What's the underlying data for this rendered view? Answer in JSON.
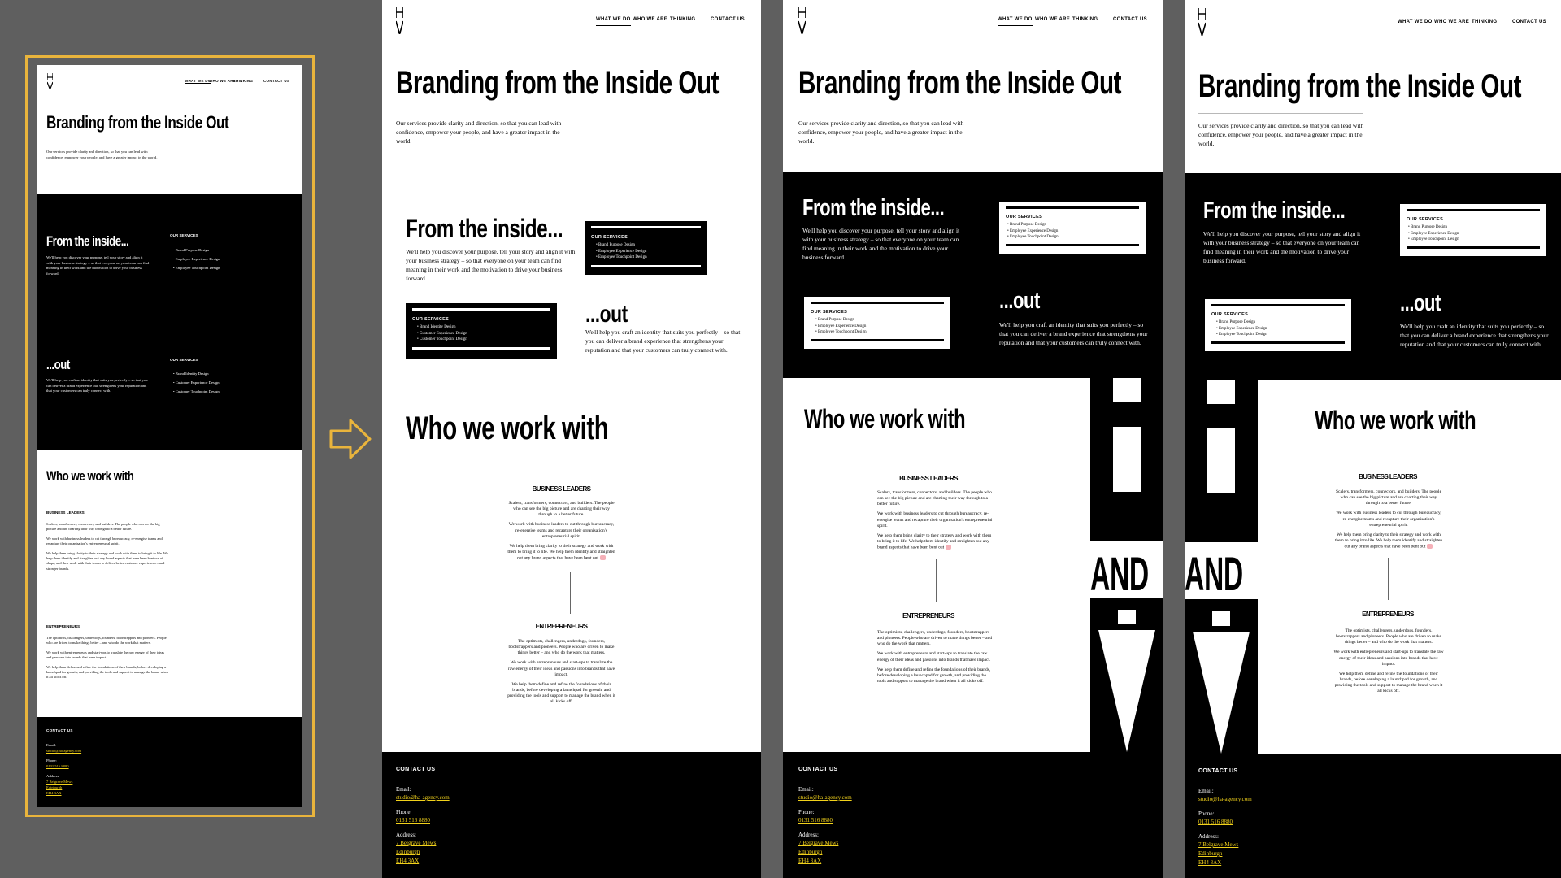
{
  "site": {
    "nav": {
      "what_we_do": "WHAT WE DO",
      "who_we_are": "WHO WE ARE",
      "thinking": "THINKING",
      "contact_us": "CONTACT US"
    },
    "hero": {
      "title": "Branding from the Inside Out",
      "intro": "Our services provide clarity and direction, so that you can lead with confidence, empower your people, and have a greater impact in the world."
    },
    "inside": {
      "title": "From the inside...",
      "body": "We'll help you discover your purpose, tell your story and align it with your business strategy – so that everyone on your team can find meaning in their work and the motivation to drive your business forward.",
      "services_title": "OUR SERVICES",
      "services": [
        "Brand Purpose Design",
        "Employee Experience Design",
        "Employee Touchpoint Design"
      ]
    },
    "out": {
      "title": "...out",
      "body": "We'll help you craft an identity that suits you perfectly – so that you can deliver a brand experience that strengthens your reputation and that your customers can truly connect with.",
      "services_title": "OUR SERVICES",
      "services": [
        "Brand Identity Design",
        "Customer Experience Design",
        "Customer Touchpoint Design"
      ],
      "services_alt": [
        "Brand Purpose Design",
        "Employee Experience Design",
        "Employee Touchpoint Design"
      ]
    },
    "who": {
      "title": "Who we work with",
      "leaders_title": "BUSINESS LEADERS",
      "leaders_p1": "Scalers, transformers, connectors, and builders. The people who can see the big picture and are charting their way through to a better future.",
      "leaders_p2": "We work with business leaders to cut through bureaucracy, re-energise teams and recapture their organisation's entrepreneurial spirit.",
      "leaders_p3": "We help them bring clarity to their strategy and work with them to bring it to life. We help them identify and straighten out any brand aspects that have been bent out of shape, and then work with their teams to deliver better customer experiences – and stronger brands.",
      "leaders_p3_short": "We help them bring clarity to their strategy and work with them to bring it to life. We help them identify and straighten out any brand aspects that have been bent out",
      "entre_title": "ENTREPRENEURS",
      "entre_p1": "The optimists, challengers, underdogs, founders, bootstrappers and pioneers. People who are driven to make things better – and who do the work that matters.",
      "entre_p2": "We work with entrepreneurs and start-ups to translate the raw energy of their ideas and passions into brands that have impact.",
      "entre_p3": "We help them define and refine the foundations of their brands, before developing a launchpad for growth, and providing the tools and support to manage the brand when it all kicks off."
    },
    "footer": {
      "title": "CONTACT US",
      "email_label": "Email:",
      "email": "studio@ha-agency.com",
      "phone_label": "Phone:",
      "phone": "0131 516 8880",
      "address_label": "Address:",
      "address": [
        "7 Belgrave Mews",
        "Edinburgh",
        "EH4 3AX"
      ]
    },
    "graphic_word": "AND"
  },
  "colors": {
    "canvas": "#5f5f5f",
    "selection": "#e9b43c",
    "link": "#f2d21b",
    "black": "#000000",
    "white": "#ffffff"
  },
  "icons": [
    "logo-mark",
    "right-arrow-icon",
    "heart-icon"
  ]
}
